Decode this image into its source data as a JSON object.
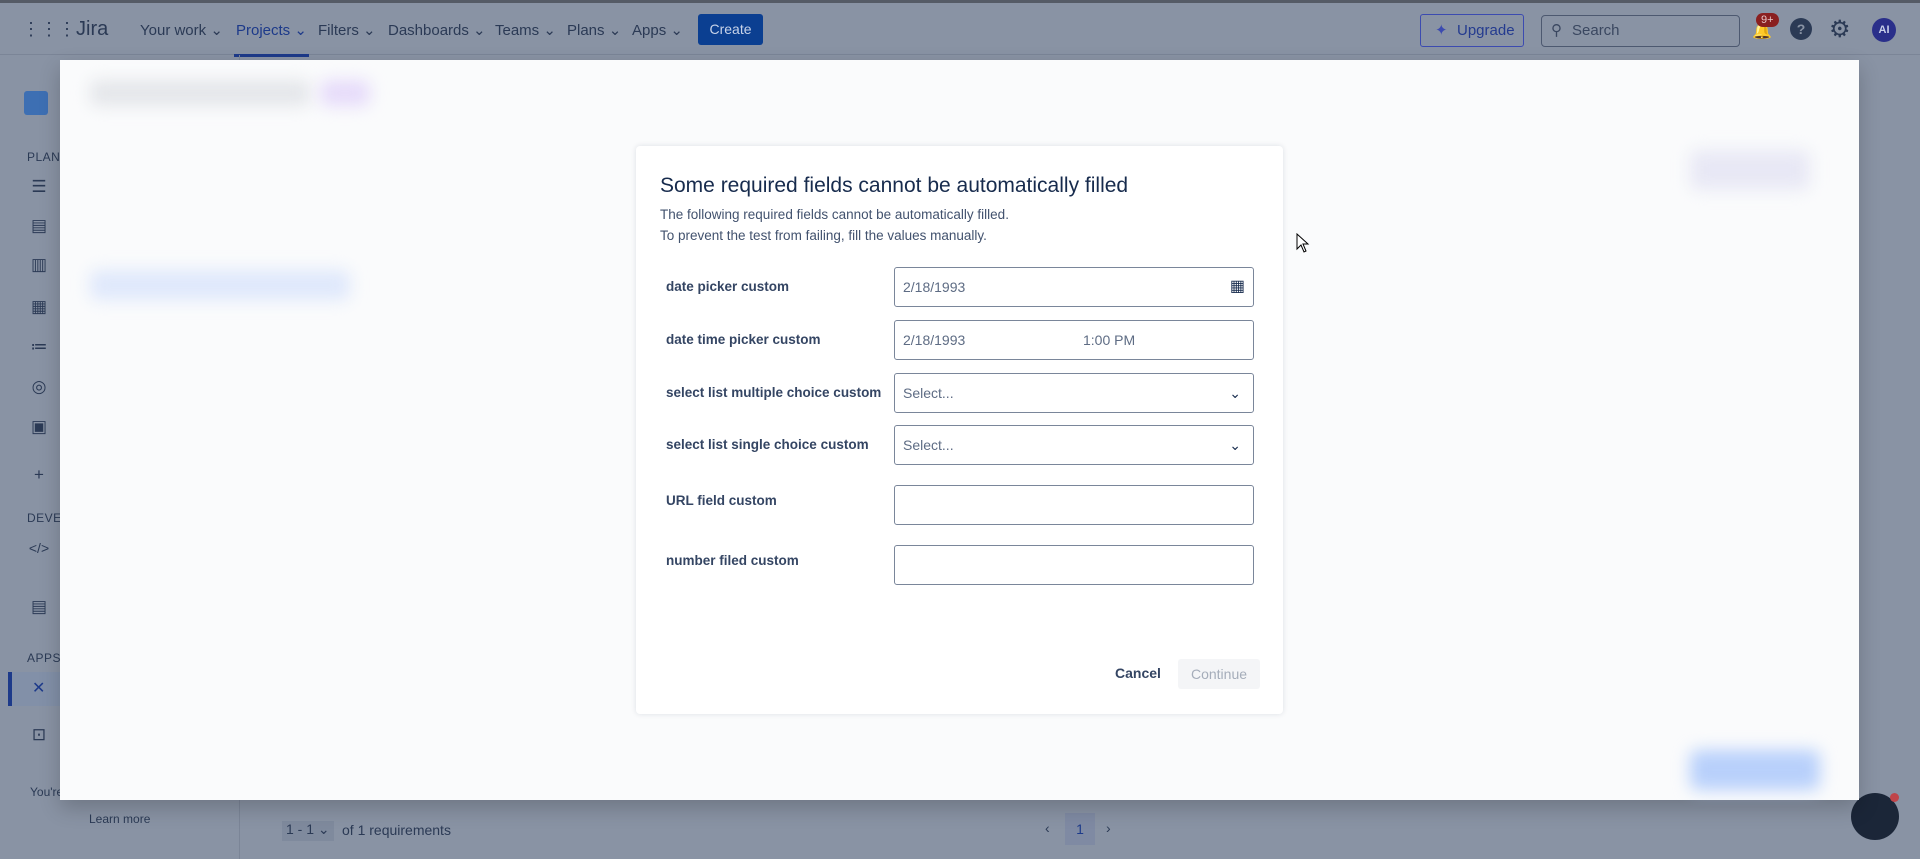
{
  "nav": {
    "logo": "Jira",
    "items": [
      "Your work",
      "Projects",
      "Filters",
      "Dashboards",
      "Teams",
      "Plans",
      "Apps"
    ],
    "create": "Create",
    "upgrade": "Upgrade",
    "search_placeholder": "Search",
    "notif_badge": "9+",
    "avatar": "AI"
  },
  "sidebar": {
    "sections": [
      "PLANNING",
      "DEVELOPMENT",
      "APPS"
    ],
    "footer_text": "You're",
    "learn_more": "Learn more"
  },
  "dialog": {
    "title": "Some required fields cannot be automatically filled",
    "sub1": "The following required fields cannot be automatically filled.",
    "sub2": "To prevent the test from failing, fill the values manually.",
    "fields": [
      {
        "label": "date picker custom",
        "value": "2/18/1993"
      },
      {
        "label": "date time picker custom",
        "date": "2/18/1993",
        "time": "1:00 PM"
      },
      {
        "label": "select list multiple choice custom",
        "placeholder": "Select..."
      },
      {
        "label": "select list single choice custom",
        "placeholder": "Select..."
      },
      {
        "label": "URL field custom",
        "value": ""
      },
      {
        "label": "number filed custom",
        "value": ""
      }
    ],
    "cancel": "Cancel",
    "continue": "Continue"
  },
  "footer": {
    "range": "1 - 1",
    "count": "of 1 requirements",
    "page": "1"
  }
}
